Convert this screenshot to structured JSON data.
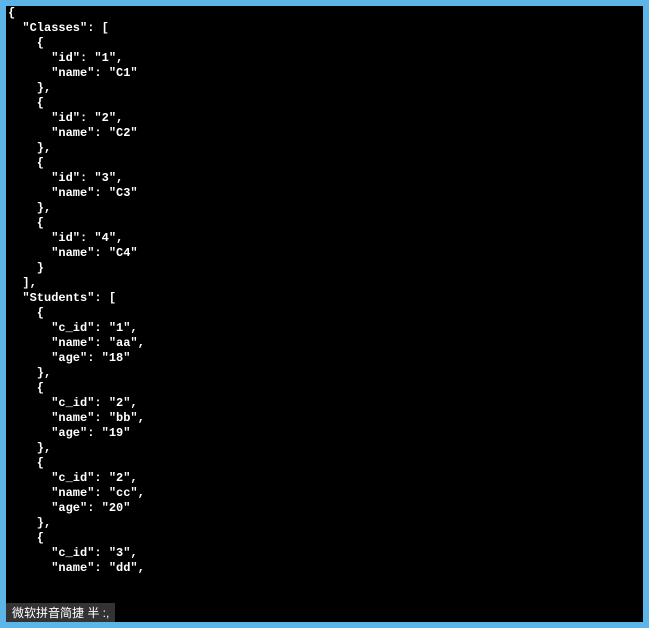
{
  "terminal": {
    "lines": [
      "{",
      "  \"Classes\": [",
      "    {",
      "      \"id\": \"1\",",
      "      \"name\": \"C1\"",
      "    },",
      "    {",
      "      \"id\": \"2\",",
      "      \"name\": \"C2\"",
      "    },",
      "    {",
      "      \"id\": \"3\",",
      "      \"name\": \"C3\"",
      "    },",
      "    {",
      "      \"id\": \"4\",",
      "      \"name\": \"C4\"",
      "    }",
      "  ],",
      "  \"Students\": [",
      "    {",
      "      \"c_id\": \"1\",",
      "      \"name\": \"aa\",",
      "      \"age\": \"18\"",
      "    },",
      "    {",
      "      \"c_id\": \"2\",",
      "      \"name\": \"bb\",",
      "      \"age\": \"19\"",
      "    },",
      "    {",
      "      \"c_id\": \"2\",",
      "      \"name\": \"cc\",",
      "      \"age\": \"20\"",
      "    },",
      "    {",
      "      \"c_id\": \"3\",",
      "      \"name\": \"dd\","
    ]
  },
  "ime": {
    "text": "微软拼音简捷 半 :,"
  }
}
